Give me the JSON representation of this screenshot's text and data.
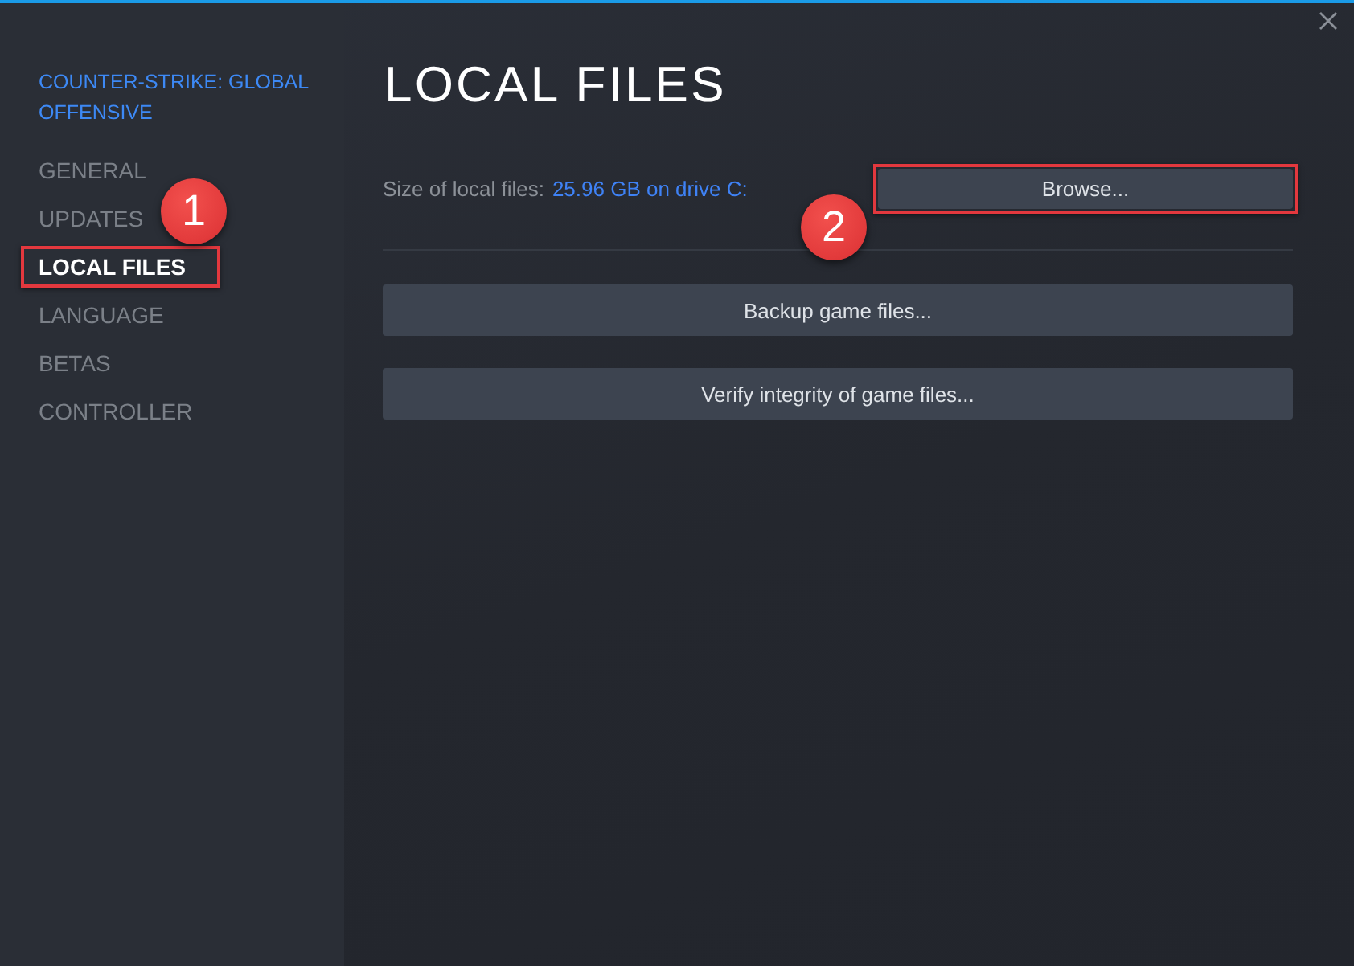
{
  "sidebar": {
    "game_title": "COUNTER-STRIKE: GLOBAL OFFENSIVE",
    "items": [
      {
        "label": "GENERAL",
        "selected": false,
        "highlighted": false
      },
      {
        "label": "UPDATES",
        "selected": false,
        "highlighted": false
      },
      {
        "label": "LOCAL FILES",
        "selected": true,
        "highlighted": true,
        "callout": "1"
      },
      {
        "label": "LANGUAGE",
        "selected": false,
        "highlighted": false
      },
      {
        "label": "BETAS",
        "selected": false,
        "highlighted": false
      },
      {
        "label": "CONTROLLER",
        "selected": false,
        "highlighted": false
      }
    ]
  },
  "page": {
    "title": "LOCAL FILES",
    "size_label": "Size of local files:",
    "size_value": "25.96 GB on drive C:",
    "browse_button": {
      "label": "Browse...",
      "highlighted": true,
      "callout": "2"
    },
    "buttons": [
      {
        "label": "Backup game files..."
      },
      {
        "label": "Verify integrity of game files..."
      }
    ]
  }
}
